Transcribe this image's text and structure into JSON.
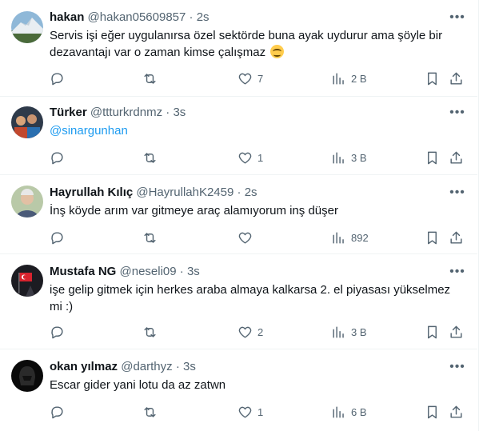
{
  "tweets": [
    {
      "name": "hakan",
      "handle": "@hakan05609857",
      "time": "2s",
      "text": "Servis işi eğer uygulanırsa özel sektörde buna ayak uydurur ama şöyle bir dezavantajı var o zaman kimse çalışmaz",
      "emoji": "smiling-face-emoji",
      "replies": "",
      "retweets": "",
      "likes": "7",
      "views": "2 B"
    },
    {
      "name": "Türker",
      "handle": "@ttturkrdnmz",
      "time": "3s",
      "text": "@sinargunhan",
      "replies": "",
      "retweets": "",
      "likes": "1",
      "views": "3 B"
    },
    {
      "name": "Hayrullah Kılıç",
      "handle": "@HayrullahK2459",
      "time": "2s",
      "text": "İnş köyde arım var gitmeye araç alamıyorum inş düşer",
      "replies": "",
      "retweets": "",
      "likes": "",
      "views": "892"
    },
    {
      "name": "Mustafa NG",
      "handle": "@neseli09",
      "time": "3s",
      "text": "işe gelip gitmek için herkes araba almaya kalkarsa 2. el piyasası yükselmez mi :)",
      "replies": "",
      "retweets": "",
      "likes": "2",
      "views": "3 B"
    },
    {
      "name": "okan yılmaz",
      "handle": "@darthyz",
      "time": "3s",
      "text": "Escar gider yani lotu da az zatwn",
      "replies": "",
      "retweets": "",
      "likes": "1",
      "views": "6 B"
    }
  ],
  "separator": "·",
  "icons": {
    "more": "more-icon",
    "reply": "reply-icon",
    "retweet": "retweet-icon",
    "like": "like-icon",
    "views": "views-icon",
    "bookmark": "bookmark-icon",
    "share": "share-icon"
  },
  "colors": {
    "text": "#0f1419",
    "secondary": "#536471",
    "link": "#1d9bf0",
    "border": "#eff3f4"
  }
}
